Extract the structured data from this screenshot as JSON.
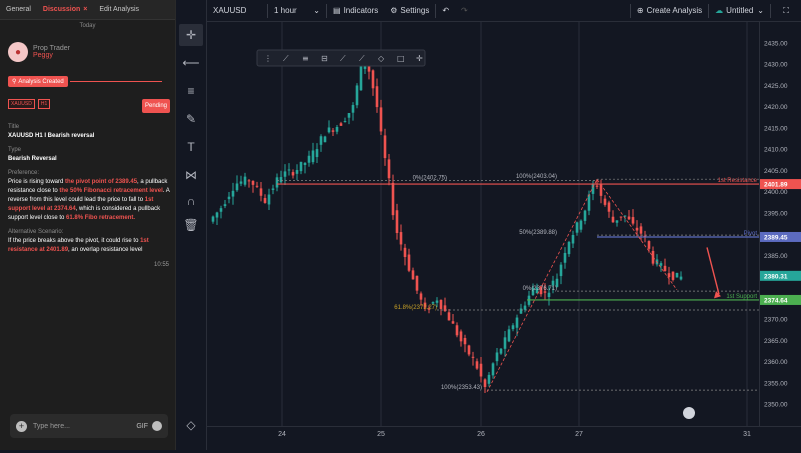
{
  "chat": {
    "tabs": [
      {
        "label": "General"
      },
      {
        "label": "Discussion",
        "close": "×"
      },
      {
        "label": "Edit Analysis"
      }
    ],
    "date_divider": "Today",
    "trader_role": "Prop Trader",
    "trader_name": "Peggy",
    "status_badge": "Analysis Created",
    "tags": [
      "XAUUSD",
      "H1"
    ],
    "pending_label": "Pending",
    "title_label": "Title",
    "title_value": "XAUUSD H1 I Bearish reversal",
    "type_label": "Type",
    "type_value": "Bearish Reversal",
    "preference_label": "Preference:",
    "preference_parts": [
      {
        "t": "Price is rising toward ",
        "h": false
      },
      {
        "t": "the pivot point of 2389.45",
        "h": true
      },
      {
        "t": ", a pullback resistance close to ",
        "h": false
      },
      {
        "t": "the 50% Fibonacci retracement level",
        "h": true
      },
      {
        "t": ". A reverse from this level could lead the price to fall to ",
        "h": false
      },
      {
        "t": "1st support level at 2374.64",
        "h": true
      },
      {
        "t": ", which is considered a pullback support level close to ",
        "h": false
      },
      {
        "t": "61.8% Fibo retracement.",
        "h": true
      }
    ],
    "alt_label": "Alternative Scenario:",
    "alt_parts": [
      {
        "t": "If the price breaks above the pivot, it could rise to ",
        "h": false
      },
      {
        "t": "1st resistance at 2401.89",
        "h": true
      },
      {
        "t": ", an overlap resistance level",
        "h": false
      }
    ],
    "time": "10:55",
    "input_placeholder": "Type here...",
    "gif_label": "GIF"
  },
  "topbar": {
    "symbol": "XAUUSD",
    "interval": "1 hour",
    "indicators_label": "Indicators",
    "settings_label": "Settings",
    "create_label": "Create Analysis",
    "layout_name": "Untitled"
  },
  "colors": {
    "accent": "#ef5350",
    "bull": "#26a69a",
    "bear": "#ef5350",
    "pivot": "#5c6bc0",
    "support": "#4caf50",
    "resistance": "#ef5350"
  },
  "chart_data": {
    "type": "candlestick",
    "symbol": "XAUUSD",
    "interval": "1 hour",
    "ylim": [
      2345,
      2440
    ],
    "y_ticks": [
      2350,
      2355,
      2360,
      2365,
      2370,
      2375,
      2380,
      2385,
      2390,
      2395,
      2400,
      2405,
      2410,
      2415,
      2420,
      2425,
      2430,
      2435
    ],
    "x_ticks": [
      "24",
      "25",
      "26",
      "27",
      "31"
    ],
    "last_price": 2380.31,
    "levels": [
      {
        "name": "1st Resistance",
        "value": 2401.89
      },
      {
        "name": "Pivot",
        "value": 2389.45
      },
      {
        "name": "1st Support",
        "value": 2374.64
      }
    ],
    "fib_labels": [
      {
        "text": "0%(2402.75)",
        "value": 2402.75
      },
      {
        "text": "100%(2403.04)",
        "value": 2403.04
      },
      {
        "text": "50%(2389.88)",
        "value": 2389.88
      },
      {
        "text": "0%(2376.71)",
        "value": 2376.71
      },
      {
        "text": "61.8%(2372.27)",
        "value": 2372.27
      },
      {
        "text": "100%(2353.43)",
        "value": 2353.43
      }
    ]
  }
}
